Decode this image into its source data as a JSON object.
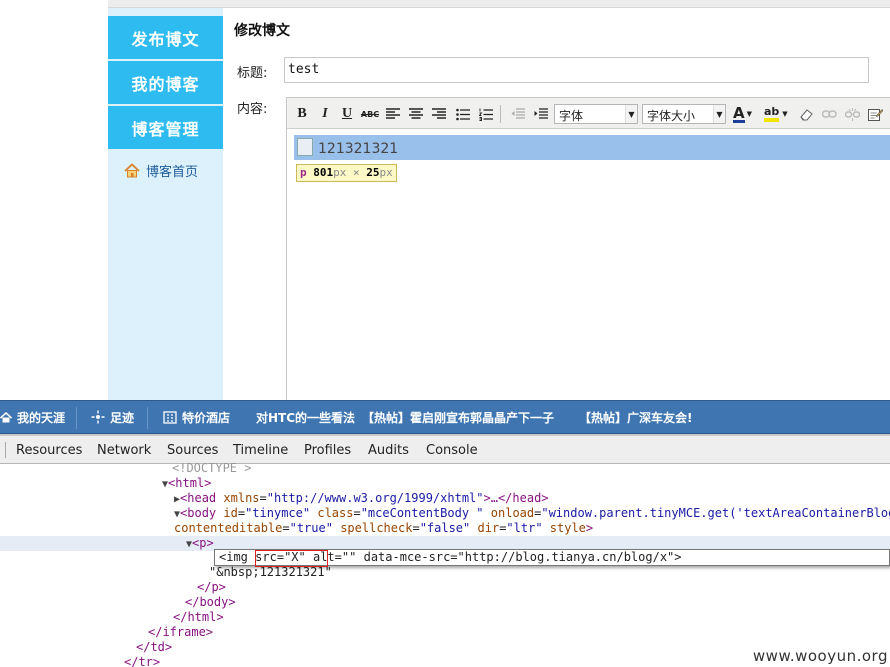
{
  "sidebar": {
    "buttons": [
      "发布博文",
      "我的博客",
      "博客管理"
    ],
    "home_link": "博客首页"
  },
  "editor_page": {
    "heading": "修改博文",
    "title_label": "标题:",
    "title_value": "test",
    "content_label": "内容:",
    "toolbar": {
      "bold": "B",
      "italic": "I",
      "underline": "U",
      "strike": "ABC",
      "font_family": "字体",
      "font_size": "字体大小",
      "font_color": "A",
      "highlight": "ab"
    },
    "content_text": "121321321",
    "element_tooltip": {
      "tag": "p",
      "width": "801",
      "height": "25",
      "unit": "px",
      "times": "×"
    }
  },
  "bookmark_bar": {
    "items": [
      "我的天涯",
      "足迹",
      "特价酒店",
      "对HTC的一些看法",
      "【热帖】霍启刚宣布郭晶晶产下一子",
      "【热帖】广深车友会!"
    ]
  },
  "devtools": {
    "tabs": [
      "Resources",
      "Network",
      "Sources",
      "Timeline",
      "Profiles",
      "Audits",
      "Console"
    ],
    "dom_lines": {
      "doctype": "<!DOCTYPE >",
      "html_open": "<html>",
      "head": {
        "open": "<head",
        "attr": "xmlns",
        "value": "\"http://www.w3.org/1999/xhtml\"",
        "rest": ">…</head>"
      },
      "body": {
        "open": "<body",
        "id_attr": "id",
        "id_val": "\"tinymce\"",
        "class_attr": "class",
        "class_val": "\"mceContentBody \"",
        "onload_attr": "onload",
        "onload_val": "\"window.parent.tinyMCE.get('textAreaContainerBlog')",
        "ce_attr": "contenteditable",
        "ce_val": "\"true\"",
        "sc_attr": "spellcheck",
        "sc_val": "\"false\"",
        "dir_attr": "dir",
        "dir_val": "\"ltr\"",
        "style_attr": "style",
        "close": ">"
      },
      "p_open": "<p>",
      "img_edit": {
        "open": "<img",
        "src_attr": "src",
        "src_val": "\"X\"",
        "alt_attr": "alt",
        "alt_val": "\"\"",
        "mce_attr": "data-mce-src",
        "mce_val": "\"http://blog.tianya.cn/blog/x\"",
        "close": ">"
      },
      "nbsp_text": "\"&nbsp;121321321\"",
      "p_close": "</p>",
      "body_close": "</body>",
      "html_close": "</html>",
      "iframe_close": "</iframe>",
      "td_close": "</td>",
      "tr_close": "</tr>"
    }
  },
  "watermark": "www.wooyun.org"
}
